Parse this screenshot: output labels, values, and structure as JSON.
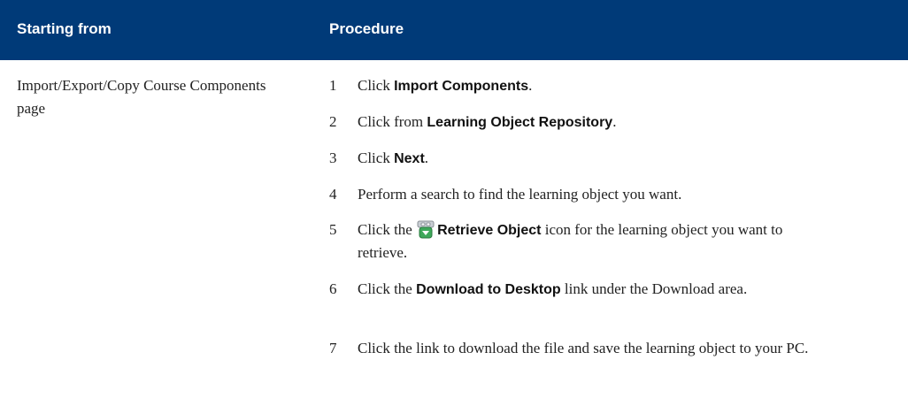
{
  "header": {
    "col1": "Starting from",
    "col2": "Procedure"
  },
  "starting_from": "Import/Export/Copy Course Components page",
  "steps": [
    {
      "num": "1",
      "pre": "Click ",
      "bold": "Import Components",
      "post": "."
    },
    {
      "num": "2",
      "pre": "Click from ",
      "bold": "Learning Object Repository",
      "post": "."
    },
    {
      "num": "3",
      "pre": "Click ",
      "bold": "Next",
      "post": "."
    },
    {
      "num": "4",
      "pre": "Perform a search to find the learning object you want.",
      "bold": "",
      "post": ""
    },
    {
      "num": "5",
      "pre": "Click the ",
      "bold": "Retrieve Object",
      "post": " icon for the learning object you want to retrieve."
    },
    {
      "num": "6",
      "pre": "Click the ",
      "bold": "Download to Desktop",
      "post": " link under the Download area."
    },
    {
      "num": "7",
      "pre": "Click the link to download the file and save the learning object to your PC.",
      "bold": "",
      "post": ""
    }
  ],
  "icons": {
    "retrieve": "retrieve-object-icon"
  },
  "colors": {
    "header_bg": "#003a78",
    "header_text": "#ffffff"
  }
}
